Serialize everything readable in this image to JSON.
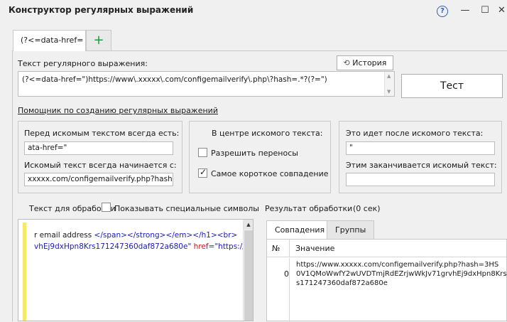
{
  "window": {
    "title": "Конструктор регулярных выражений",
    "help": "?",
    "minimize": "—",
    "maximize": "☐",
    "close": "✕"
  },
  "tabs": {
    "active_label": "(?<=data-href=",
    "add_label": "+"
  },
  "regex": {
    "label": "Текст регулярного выражения:",
    "value": "(?<=data-href=\")https://www\\.xxxxx\\.com/configemailverify\\.php\\?hash=.*?(?=\")",
    "history_label": "История",
    "test_label": "Тест"
  },
  "helper": {
    "link": "Помощник по созданию регулярных выражений",
    "before": {
      "label": "Перед искомым текстом всегда есть:",
      "value": "ata-href=\"",
      "starts_label": "Искомый текст всегда начинается с:",
      "starts_value": "xxxxx.com/configemailverify.php?hash="
    },
    "center": {
      "label": "В центре искомого текста:",
      "allow_wrap": "Разрешить переносы",
      "allow_wrap_checked": false,
      "shortest": "Самое короткое совпадение",
      "shortest_checked": true
    },
    "after": {
      "label": "Это идет после искомого текста:",
      "value": "\"",
      "ends_label": "Этим заканчивается искомый текст:",
      "ends_value": ""
    }
  },
  "input_text": {
    "label": "Текст для обработки",
    "show_special": "Показывать специальные символы",
    "line1_text": "r email address ",
    "line1_tags": "</span></strong></em></h1><br>",
    "line2_value": "vhEj9dxHpn8Krs171247360daf872a680e\"",
    "line2_attr": " href=",
    "line2_url": "\"https://www"
  },
  "result": {
    "label": "Результат обработки",
    "time": "(0 сек)",
    "tab_matches": "Совпадения",
    "tab_groups": "Группы",
    "col_num": "№",
    "col_value": "Значение",
    "rows": [
      {
        "num": "0",
        "line1": "https://www.xxxxx.com/configemailverify.php?hash=3HS",
        "line2": "0V1QMoWwfY2wUVDTmjRdEZrjwWkJv71grvhEj9dxHpn8Krs",
        "line3": "s171247360daf872a680e"
      }
    ]
  }
}
